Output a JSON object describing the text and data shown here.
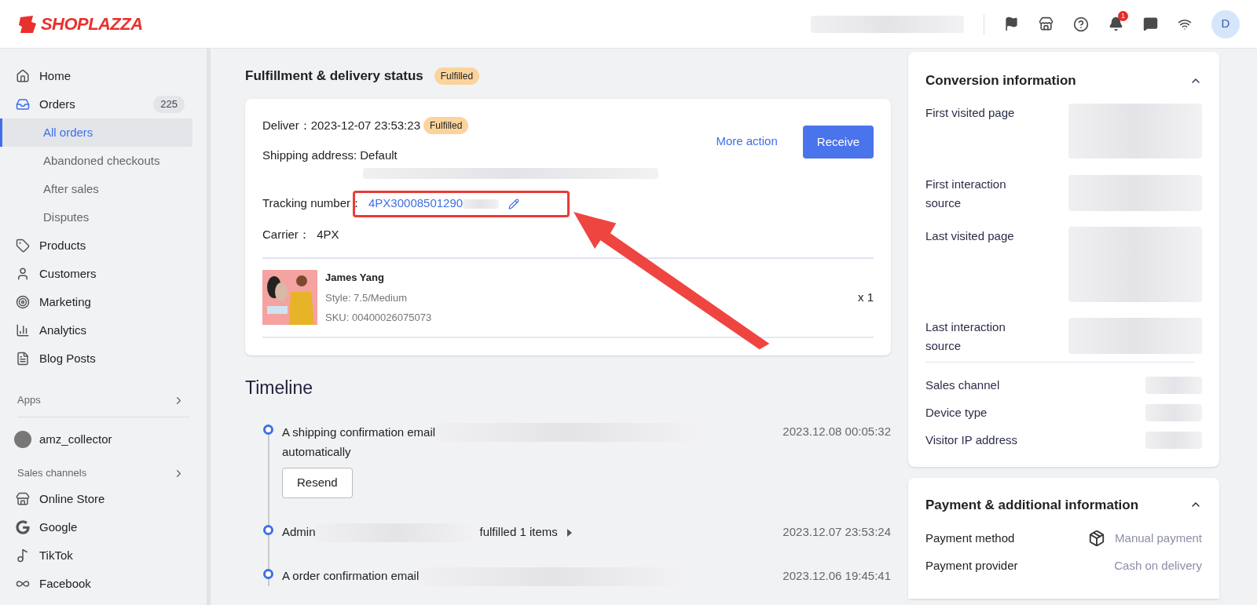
{
  "header": {
    "logo": "SHOPLAZZA",
    "notification_count": "1",
    "avatar_initial": "D"
  },
  "sidebar": {
    "items": [
      {
        "label": "Home",
        "selected": false
      },
      {
        "label": "Orders",
        "count": "225",
        "selected": false,
        "children": [
          {
            "label": "All orders",
            "selected": true
          },
          {
            "label": "Abandoned checkouts",
            "selected": false
          },
          {
            "label": "After sales",
            "selected": false
          },
          {
            "label": "Disputes",
            "selected": false
          }
        ]
      },
      {
        "label": "Products",
        "selected": false
      },
      {
        "label": "Customers",
        "selected": false
      },
      {
        "label": "Marketing",
        "selected": false
      },
      {
        "label": "Analytics",
        "selected": false
      },
      {
        "label": "Blog Posts",
        "selected": false
      }
    ],
    "apps_heading": "Apps",
    "apps": [
      {
        "label": "amz_collector"
      }
    ],
    "sales_heading": "Sales channels",
    "channels": [
      {
        "label": "Online Store"
      },
      {
        "label": "Google"
      },
      {
        "label": "TikTok"
      },
      {
        "label": "Facebook"
      }
    ]
  },
  "fulfillment": {
    "title": "Fulfillment & delivery status",
    "badge": "Fulfilled",
    "deliver_label": "Deliver：",
    "deliver_date": "2023-12-07 23:53:23",
    "deliver_badge": "Fulfilled",
    "more_action": "More action",
    "receive": "Receive",
    "shipping_address": "Shipping address: Default",
    "tracking_label": "Tracking number：",
    "tracking_number": "4PX30008501290",
    "carrier": "Carrier：  4PX",
    "product": {
      "name": "James Yang",
      "style": "Style: 7.5/Medium",
      "sku": "SKU: 00400026075073",
      "quantity": "x 1"
    }
  },
  "timeline": {
    "title": "Timeline",
    "events": [
      {
        "before": "A shipping confirmation email",
        "second_line": "automatically",
        "time": "2023.12.08 00:05:32",
        "button": "Resend"
      },
      {
        "before": "Admin",
        "after": "fulfilled 1 items",
        "time": "2023.12.07 23:53:24",
        "expandable": true
      },
      {
        "before": "A order confirmation email",
        "time": "2023.12.06 19:45:41"
      }
    ]
  },
  "conversion": {
    "title": "Conversion information",
    "expanded": true,
    "rows": [
      {
        "label": "First visited page",
        "kind": "tall"
      },
      {
        "label": "First interaction source",
        "kind": "short"
      },
      {
        "label": "Last visited page",
        "kind": "tallest"
      },
      {
        "label": "Last interaction source",
        "kind": "short"
      }
    ],
    "rows2": [
      {
        "label": "Sales channel"
      },
      {
        "label": "Device type"
      },
      {
        "label": "Visitor IP address"
      }
    ]
  },
  "payment": {
    "title": "Payment & additional information",
    "expanded": true,
    "rows": [
      {
        "label": "Payment method",
        "value": "Manual payment",
        "kind": "with-icon"
      },
      {
        "label": "Payment provider",
        "value": "Cash on delivery",
        "kind": "plain"
      }
    ]
  }
}
